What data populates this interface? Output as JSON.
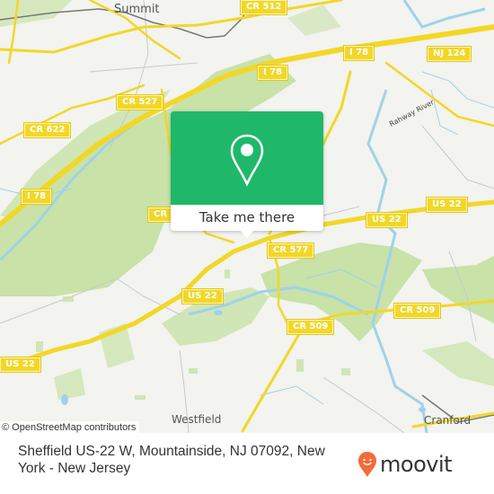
{
  "map": {
    "attribution": "© OpenStreetMap contributors",
    "places": [
      {
        "id": "summit",
        "label": "Summit"
      },
      {
        "id": "westfield",
        "label": "Westfield"
      },
      {
        "id": "cranford",
        "label": "Cranford"
      }
    ],
    "river_label": "Rahway River",
    "road_shields": [
      {
        "id": "cr512",
        "label": "CR 512"
      },
      {
        "id": "i78-top",
        "label": "I 78"
      },
      {
        "id": "nj124",
        "label": "NJ 124"
      },
      {
        "id": "i78-mid",
        "label": "I 78"
      },
      {
        "id": "cr527",
        "label": "CR 527"
      },
      {
        "id": "cr622",
        "label": "CR 622"
      },
      {
        "id": "i78-left",
        "label": "I 78"
      },
      {
        "id": "cr-partial",
        "label": "CR"
      },
      {
        "id": "us22-right",
        "label": "US 22"
      },
      {
        "id": "cr577",
        "label": "CR 577"
      },
      {
        "id": "us22-center",
        "label": "US 22"
      },
      {
        "id": "cr509-right",
        "label": "CR 509"
      },
      {
        "id": "cr509-center",
        "label": "CR 509"
      },
      {
        "id": "us22-mid",
        "label": "US 22"
      },
      {
        "id": "us22-left",
        "label": "US 22"
      }
    ],
    "colors": {
      "background": "#f3f3ef",
      "park": "#c8e2a8",
      "road": "#f2d727",
      "water": "#9fd2ea",
      "rail": "#777777"
    }
  },
  "popup": {
    "icon": "location-pin-icon",
    "button_label": "Take me there",
    "color": "#1fb86a"
  },
  "footer": {
    "address": "Sheffield US-22 W, Mountainside, NJ 07092, New York - New Jersey",
    "brand": "moovit",
    "brand_color": "#f26b3a"
  }
}
